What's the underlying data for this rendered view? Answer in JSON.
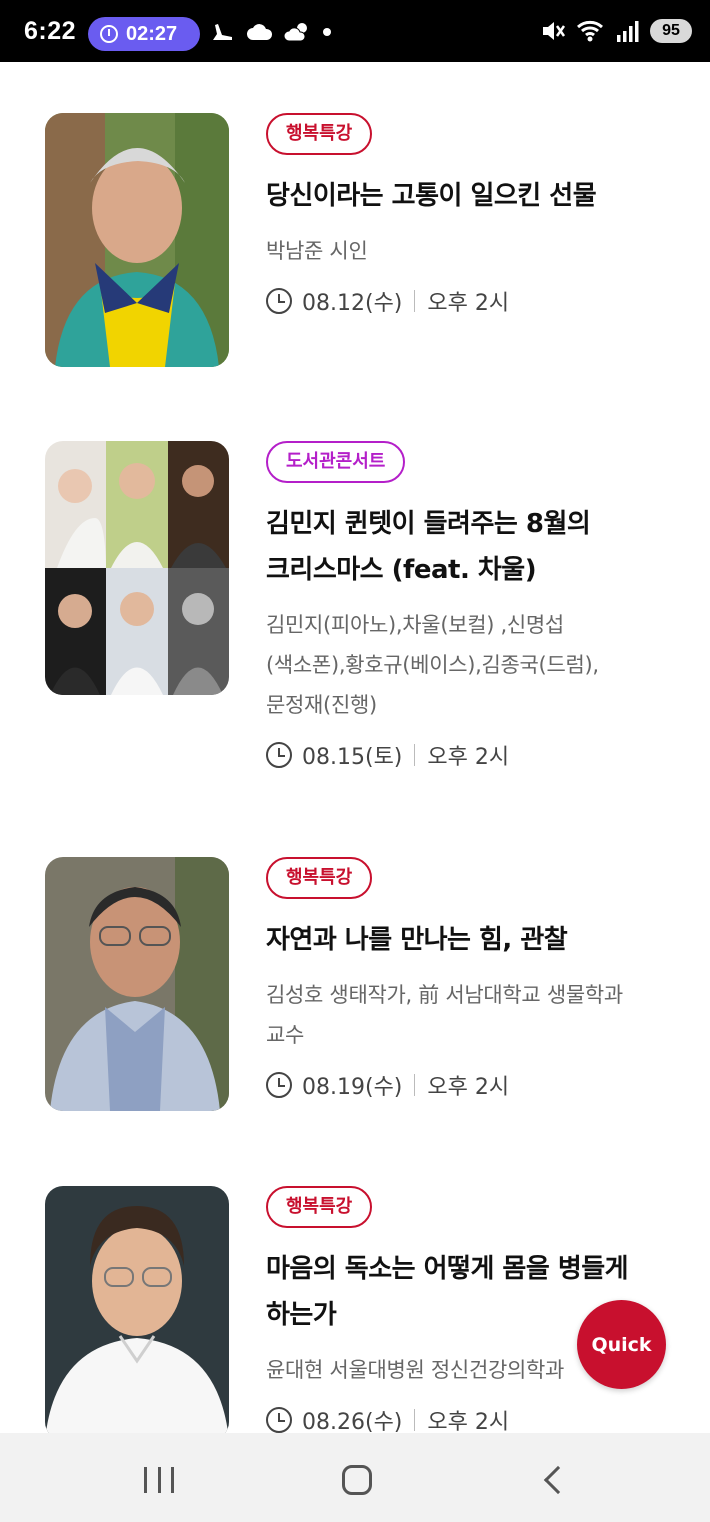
{
  "status_bar": {
    "time": "6:22",
    "alarm_time": "02:27",
    "battery": "95",
    "left_icons": [
      "stride-icon",
      "cloud-icon",
      "partly-sunny-icon",
      "dot-icon"
    ],
    "right_icons": [
      "mute-icon",
      "wifi-icon",
      "signal-icon"
    ]
  },
  "items": [
    {
      "tag": "행복특강",
      "tag_color": "#c8102e",
      "title_lines": [
        "당신이라는 고통이 일으킨 선물"
      ],
      "who_lines": [
        "박남준 시인"
      ],
      "date": "08.12(수)",
      "time": "오후 2시"
    },
    {
      "tag": "도서관콘서트",
      "tag_color": "#b41fc9",
      "title_lines": [
        "김민지 퀸텟이 들려주는 8월의",
        "크리스마스 (feat. 차울)"
      ],
      "who_lines": [
        "김민지(피아노),차울(보컬) ,신명섭",
        "(색소폰),황호규(베이스),김종국(드럼),",
        "문정재(진행)"
      ],
      "date": "08.15(토)",
      "time": "오후 2시"
    },
    {
      "tag": "행복특강",
      "tag_color": "#c8102e",
      "title_lines": [
        "자연과 나를 만나는 힘, 관찰"
      ],
      "who_lines": [
        "김성호 생태작가, 前 서남대학교 생물학과",
        "교수"
      ],
      "date": "08.19(수)",
      "time": "오후 2시"
    },
    {
      "tag": "행복특강",
      "tag_color": "#c8102e",
      "title_lines": [
        "마음의 독소는 어떻게 몸을 병들게",
        "하는가"
      ],
      "who_lines": [
        "윤대현 서울대병원 정신건강의학과"
      ],
      "date": "08.26(수)",
      "time": "오후 2시"
    }
  ],
  "quick_button": "Quick",
  "nav": {
    "recents_icon": "recents-icon",
    "home_icon": "home-icon",
    "back_icon": "back-icon"
  }
}
